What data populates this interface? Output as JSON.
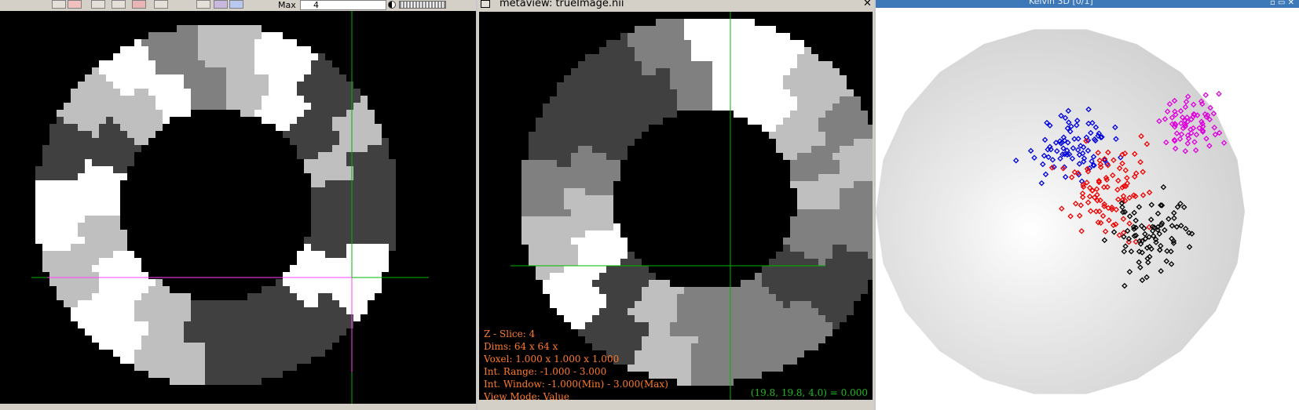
{
  "left_panel": {
    "max_label": "Max",
    "max_value": "4",
    "toolbar_icons": [
      "toolbar-button-icon",
      "undo-icon",
      "pen-icon",
      "arrow-icon",
      "delete-icon",
      "arrow-icon",
      "pointer-icon",
      "color-icon",
      "star-icon"
    ]
  },
  "metaview": {
    "window_title": "metaview: trueImage.nii",
    "close_glyph": "✕",
    "info": {
      "z_slice": "Z - Slice:   4",
      "dims": "Dims:  64 x  64 x",
      "voxel": "Voxel: 1.000 x 1.000 x 1.000",
      "int_range": "Int. Range: -1.000 - 3.000",
      "int_window": "Int. Window: -1.000(Min) - 3.000(Max)",
      "view_mode": "View Mode: Value"
    },
    "cursor_readout": "(19.8,  19.8,  4.0) = 0.000"
  },
  "scatter_window": {
    "title": "Kelvin 3D [0/1]"
  },
  "colors": {
    "info_text": "#ff7a2a",
    "readout_text": "#1eba1e",
    "crosshair": "#00b400",
    "crosshair_magenta": "#ff40ff",
    "cluster_blue": "#0000dd",
    "cluster_red": "#ee0000",
    "cluster_black": "#000000",
    "cluster_magenta": "#dd00dd",
    "gray_levels": [
      "#000000",
      "#404040",
      "#808080",
      "#bfbfbf",
      "#ffffff"
    ]
  }
}
